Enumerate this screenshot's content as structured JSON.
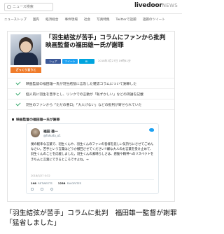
{
  "header": {
    "search_placeholder": "ニュース検索",
    "logo_main": "livedoor",
    "logo_sub": "NEWS"
  },
  "nav": {
    "items": [
      "ニューストップ",
      "国内",
      "経済総合",
      "事件現場",
      "社会",
      "写真特集",
      "Twitterで話題",
      "話題のツイート"
    ]
  },
  "article": {
    "headline": "「羽生結弦が苦手」コラムにファンから批判 映画監督の福田雄一氏が謝罪",
    "badge": "ざっくり言うと",
    "share": {
      "facebook": "シェア",
      "twitter": "ツイート",
      "hatena": "B!"
    },
    "date": "2018年3月27日 19時41分",
    "points": [
      "映画監督の福田雄一氏が羽生結弦に言及した雑誌コラムについて謝罪した",
      "個人的に羽生を苦手とし、リンクでの言動が「恥ずかしい」などの持論を記載",
      "羽生のファンから「ただの悪口」「大人げない」などの批判が寄せられていた"
    ],
    "section_title": "映画監督の福田雄一氏が謝罪"
  },
  "tweet": {
    "name": "福田 雄一",
    "handle": "@fukuda_u1",
    "text": "僕の軽率な言葉で、羽生くんや、羽生くんのファンの皆様を悲しい気持ちにさせてごめんなさい。苦手という言葉はどうか撤回させてください!!嫌な大人のお言葉を受け止めて、羽生くんのことを応援しました。羽生くんの素晴らしさは、感動や精神へのリスペクトをきちんと言葉にできるところですよね。→",
    "time": "2018/3/27 0:32",
    "retweets": "198",
    "retweets_label": "RETWEETS",
    "likes": "1236",
    "likes_label": "FAVORITES"
  },
  "caption": "「羽生結弦が苦手」コラムに批判　福田雄一監督が謝罪「猛省しました」",
  "colors": {
    "accent_orange": "#f07c2b",
    "check_green": "#35a86b",
    "facebook_blue": "#3b5998",
    "twitter_blue": "#1da1f2"
  }
}
